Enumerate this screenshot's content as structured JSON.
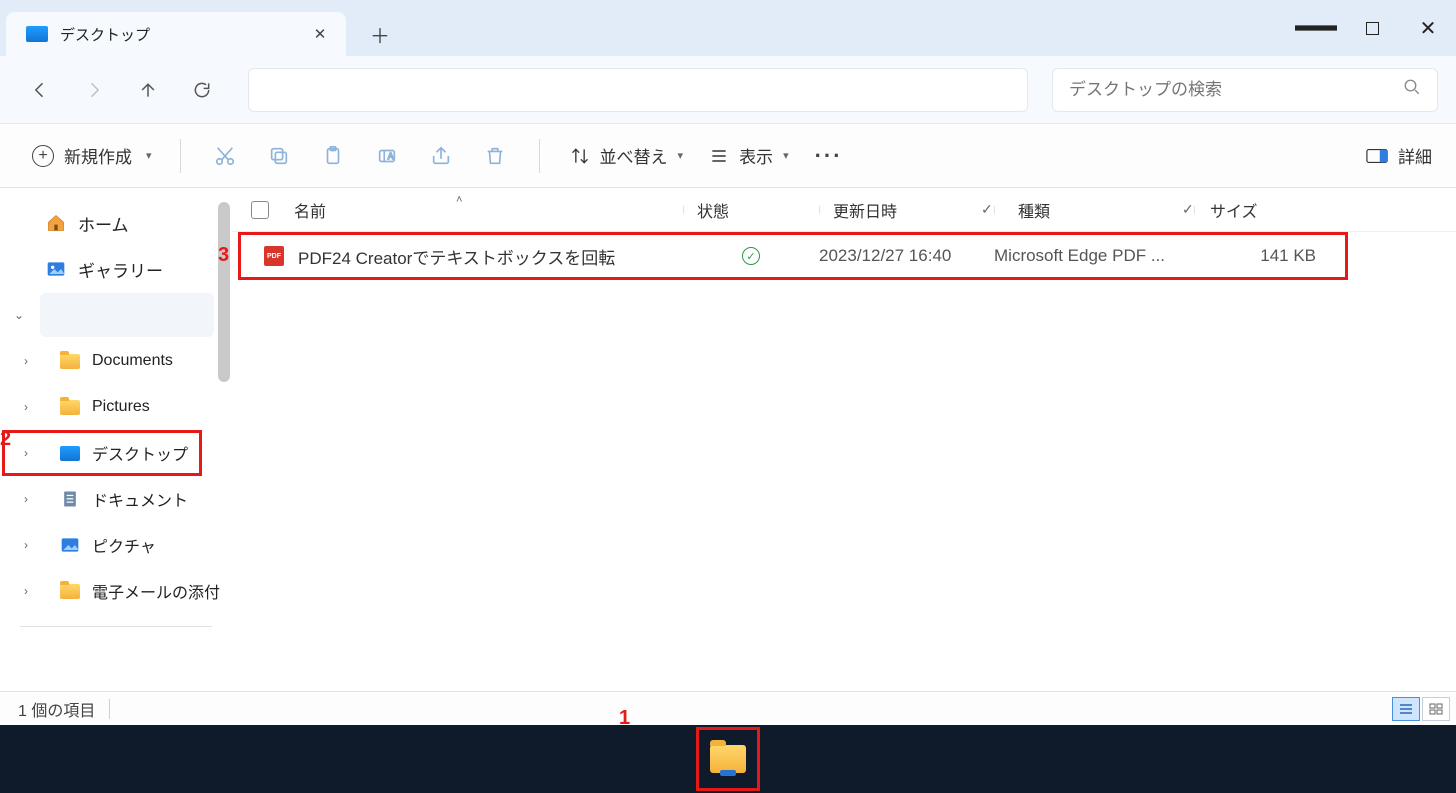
{
  "window": {
    "tab_title": "デスクトップ",
    "search_placeholder": "デスクトップの検索"
  },
  "toolbar": {
    "new_label": "新規作成",
    "sort_label": "並べ替え",
    "view_label": "表示",
    "details_label": "詳細"
  },
  "columns": {
    "name": "名前",
    "state": "状態",
    "modified": "更新日時",
    "type": "種類",
    "size": "サイズ"
  },
  "sidebar": {
    "home": "ホーム",
    "gallery": "ギャラリー",
    "documents": "Documents",
    "pictures": "Pictures",
    "desktop": "デスクトップ",
    "documents_jp": "ドキュメント",
    "pictures_jp": "ピクチャ",
    "email_att": "電子メールの添付"
  },
  "files": [
    {
      "name": "PDF24 Creatorでテキストボックスを回転",
      "modified": "2023/12/27 16:40",
      "type": "Microsoft Edge PDF ...",
      "size": "141 KB"
    }
  ],
  "statusbar": {
    "items_text": "1 個の項目"
  },
  "annotations": {
    "one": "1",
    "two": "2",
    "three": "3"
  }
}
